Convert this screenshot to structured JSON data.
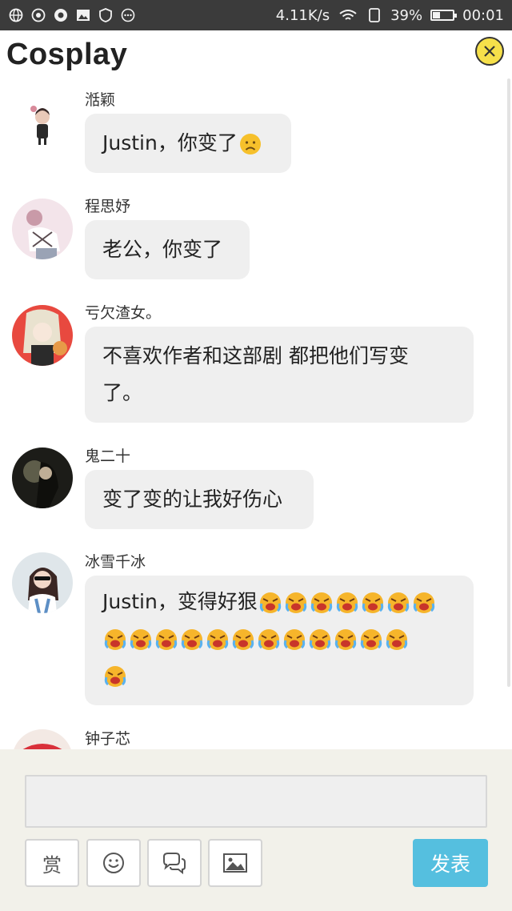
{
  "status_bar": {
    "network_speed": "4.11K/s",
    "battery_percent": "39%",
    "battery_level": 0.39,
    "time": "00:01",
    "left_icons": [
      "globe-icon",
      "sync-icon",
      "aperture-icon",
      "image-icon",
      "shield-icon",
      "more-dots-icon"
    ]
  },
  "header": {
    "title": "Cosplay",
    "close_icon": "close-icon"
  },
  "messages": [
    {
      "name": "湉颖",
      "text": "Justin，你变了",
      "emoji_count": 1,
      "emoji": "sad-face-emoji",
      "emoji_wrap": 0
    },
    {
      "name": "程思妤",
      "text": "老公，你变了",
      "emoji_count": 0,
      "emoji_wrap": 0
    },
    {
      "name": "亏欠渣女。",
      "text_line1": "不喜欢作者和这部剧 都把他们写变",
      "text_line2": "了。",
      "emoji_count": 0,
      "emoji_wrap": 0
    },
    {
      "name": "鬼二十",
      "text": "变了变的让我好伤心",
      "emoji_count": 0,
      "emoji_wrap": 0
    },
    {
      "name": "冰雪千冰",
      "text": "Justin，变得好狠",
      "emoji_count": 20,
      "emoji": "crying-face-emoji",
      "emoji_wrap": 7
    },
    {
      "name": "钟子芯",
      "text": "",
      "emoji_count": 0
    }
  ],
  "composer": {
    "input_value": "",
    "reward_label": "赏",
    "send_label": "发表",
    "tool_icons": [
      "smiley-icon",
      "chat-bubbles-icon",
      "image-icon"
    ]
  },
  "colors": {
    "status_bar_bg": "#3b3b3b",
    "bubble_bg": "#efefef",
    "close_button": "#f6e04a",
    "send_button": "#55bfdf",
    "composer_bg": "#f2f1ea"
  }
}
